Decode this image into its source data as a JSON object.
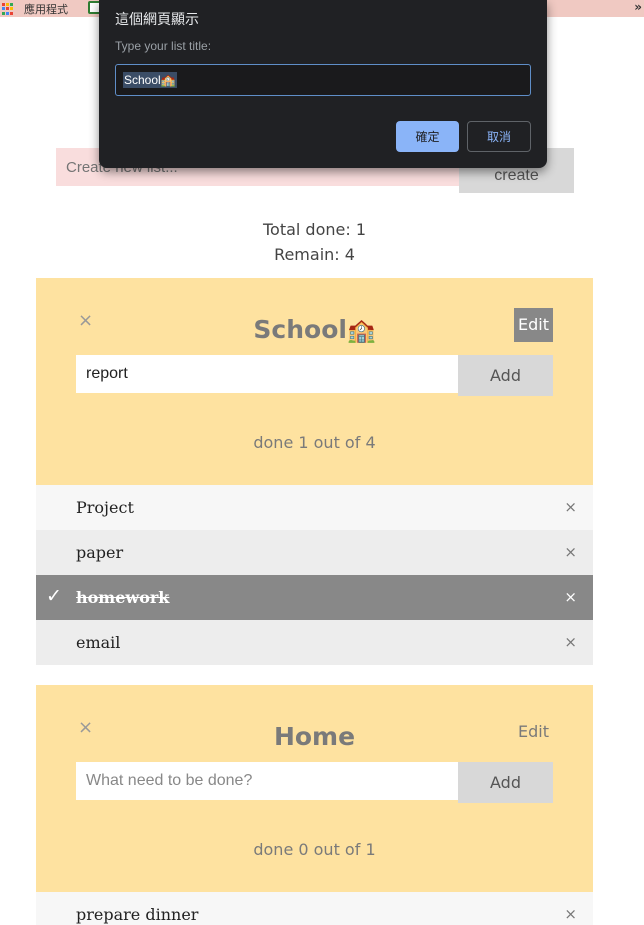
{
  "browser": {
    "apps_label": "應用程式",
    "more_label": "»",
    "apps_icon_colors": [
      "#ea4335",
      "#fbbc05",
      "#34a853",
      "#4285f4",
      "#ea4335",
      "#fbbc05",
      "#34a853",
      "#4285f4",
      "#ea4335"
    ]
  },
  "app": {
    "new_list_placeholder": "Create new list...",
    "create_label": "create",
    "total_done": "Total done: 1",
    "remain": "Remain: 4"
  },
  "lists": [
    {
      "title": "School",
      "title_emoji": "🏫",
      "edit_label": "Edit",
      "delete_label": "×",
      "input_value": "report",
      "input_placeholder": "What need to be done?",
      "add_label": "Add",
      "progress": "done 1 out of 4",
      "items": [
        {
          "label": "Project",
          "done": false,
          "remove_label": "×"
        },
        {
          "label": "paper",
          "done": false,
          "remove_label": "×"
        },
        {
          "label": "homework",
          "done": true,
          "remove_label": "×",
          "check_label": "✓"
        },
        {
          "label": "email",
          "done": false,
          "remove_label": "×"
        }
      ]
    },
    {
      "title": "Home",
      "edit_label": "Edit",
      "delete_label": "×",
      "input_value": "",
      "input_placeholder": "What need to be done?",
      "add_label": "Add",
      "progress": "done 0 out of 1",
      "items": [
        {
          "label": "prepare dinner",
          "done": false,
          "remove_label": "×"
        }
      ]
    }
  ],
  "dialog": {
    "title": "這個網頁顯示",
    "message": "Type your list title:",
    "input_value": "School",
    "input_emoji": "🏫",
    "ok_label": "確定",
    "cancel_label": "取消"
  },
  "colors": {
    "card_header": "#fee2a0",
    "done_item": "#888888",
    "dialog_bg": "#202124",
    "dialog_accent": "#8ab4f8",
    "bookmarks_bar": "#f0c9c2"
  }
}
